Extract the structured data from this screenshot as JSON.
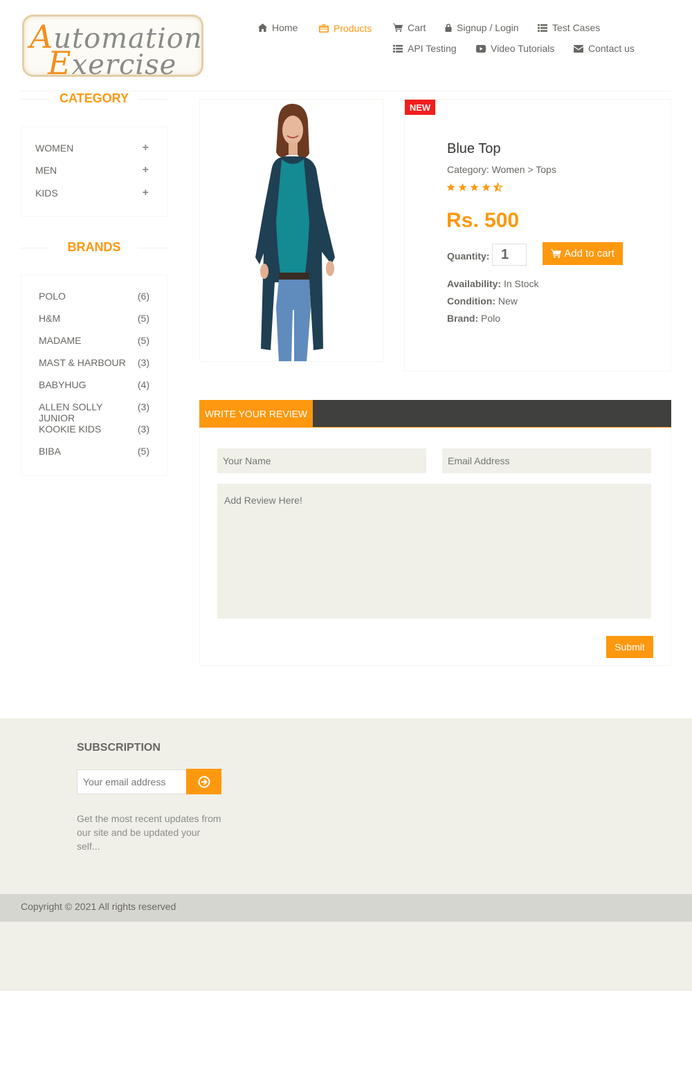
{
  "logo": {
    "line1_cap": "A",
    "line1_rest": "utomation",
    "line2_cap": "E",
    "line2_rest": "xercise"
  },
  "nav": {
    "home": "Home",
    "products": "Products",
    "cart": "Cart",
    "signup": "Signup / Login",
    "test_cases": "Test Cases",
    "api_testing": "API Testing",
    "video_tutorials": "Video Tutorials",
    "contact": "Contact us"
  },
  "sidebar": {
    "category_title": "CATEGORY",
    "categories": [
      {
        "label": "WOMEN",
        "toggle": "+"
      },
      {
        "label": "MEN",
        "toggle": "+"
      },
      {
        "label": "KIDS",
        "toggle": "+"
      }
    ],
    "brands_title": "BRANDS",
    "brands": [
      {
        "name": "POLO",
        "count": "(6)"
      },
      {
        "name": "H&M",
        "count": "(5)"
      },
      {
        "name": "MADAME",
        "count": "(5)"
      },
      {
        "name": "MAST & HARBOUR",
        "count": "(3)"
      },
      {
        "name": "BABYHUG",
        "count": "(4)"
      },
      {
        "name": "ALLEN SOLLY JUNIOR",
        "count": "(3)"
      },
      {
        "name": "KOOKIE KIDS",
        "count": "(3)"
      },
      {
        "name": "BIBA",
        "count": "(5)"
      }
    ]
  },
  "product": {
    "badge": "NEW",
    "name": "Blue Top",
    "category": "Category: Women > Tops",
    "rating": 4.5,
    "price": "Rs. 500",
    "quantity_label": "Quantity:",
    "quantity_value": "1",
    "add_to_cart": "Add to cart",
    "availability_label": "Availability:",
    "availability_value": " In Stock",
    "condition_label": "Condition:",
    "condition_value": " New",
    "brand_label": "Brand:",
    "brand_value": " Polo"
  },
  "review": {
    "tab_label": "WRITE YOUR REVIEW",
    "name_placeholder": "Your Name",
    "email_placeholder": "Email Address",
    "review_placeholder": "Add Review Here!",
    "submit": "Submit"
  },
  "footer": {
    "subscription_title": "SUBSCRIPTION",
    "email_placeholder": "Your email address",
    "subscription_text": "Get the most recent updates from our site and be updated your self...",
    "copyright": "Copyright © 2021 All rights reserved"
  },
  "colors": {
    "accent": "#fe980f",
    "badge": "#f21d1d",
    "dark_bar": "#40403e",
    "footer_bg": "#f0f0e9"
  }
}
